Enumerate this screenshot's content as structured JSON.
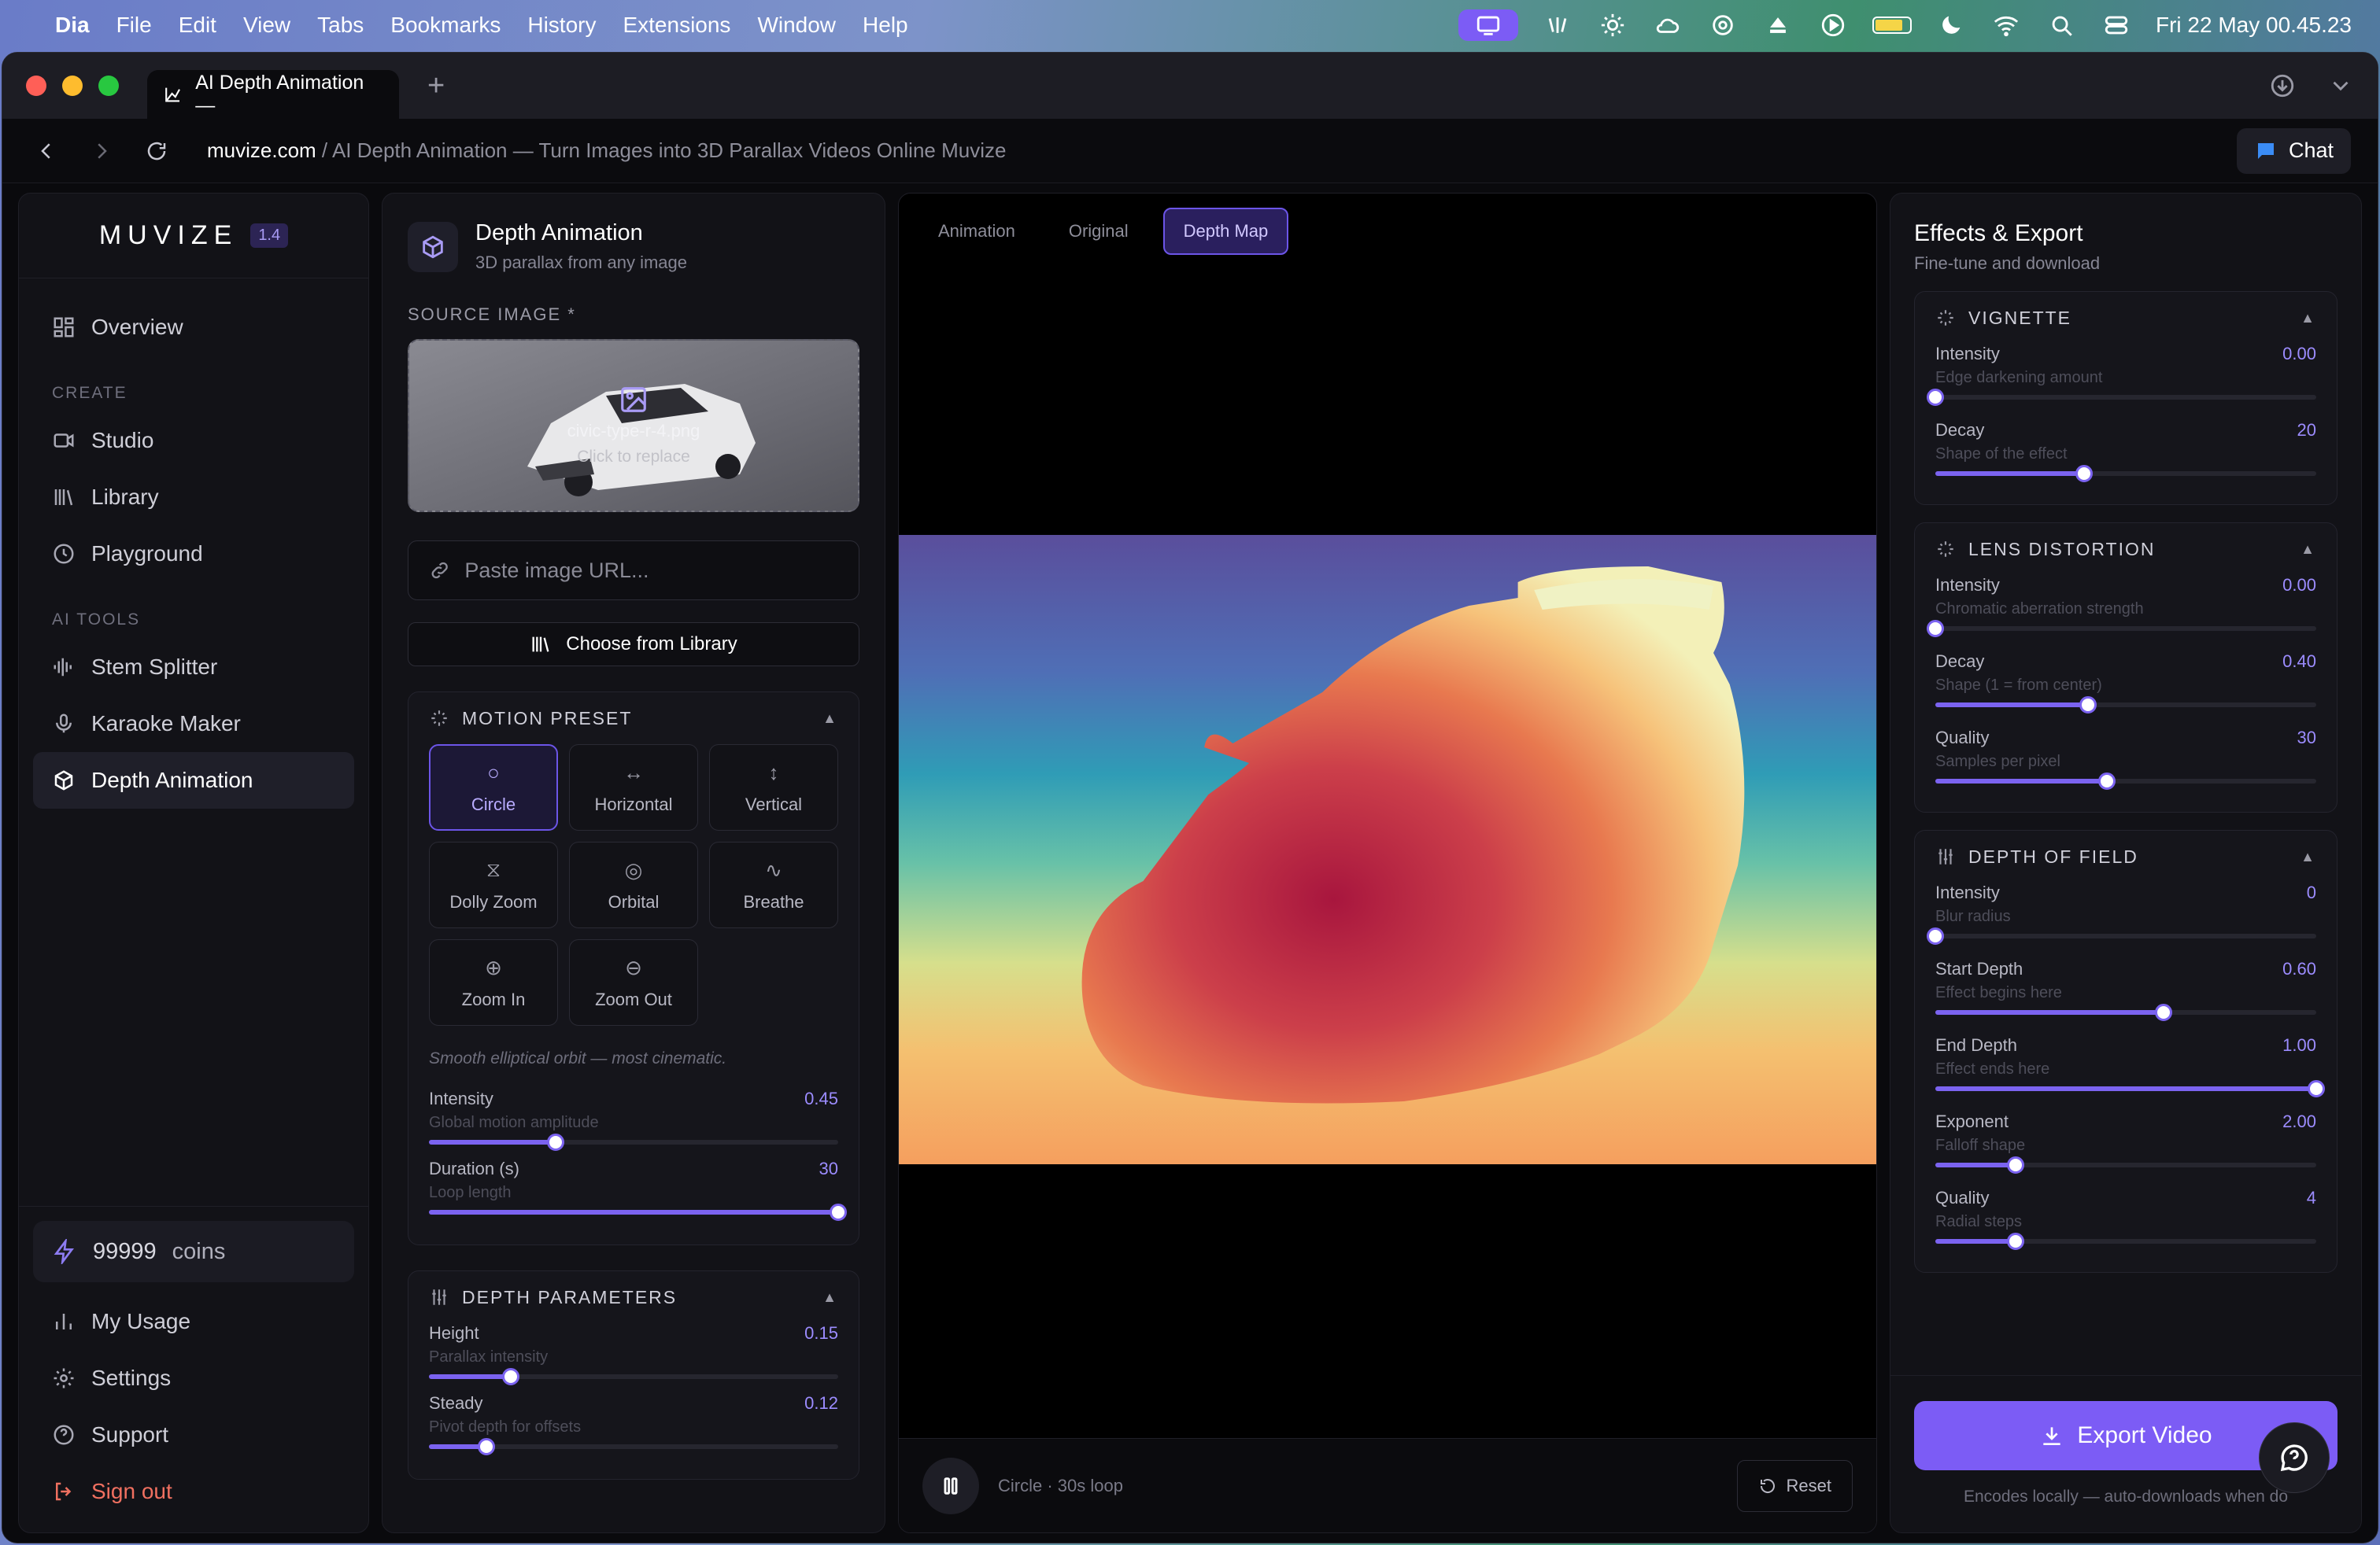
{
  "menubar": {
    "app": "Dia",
    "items": [
      "File",
      "Edit",
      "View",
      "Tabs",
      "Bookmarks",
      "History",
      "Extensions",
      "Window",
      "Help"
    ],
    "clock": "Fri 22 May  00.45.23"
  },
  "browser": {
    "tab_title": "AI Depth Animation —",
    "url_host": "muvize.com",
    "url_path": " / AI Depth Animation — Turn Images into 3D Parallax Videos Online Muvize",
    "chat_label": "Chat"
  },
  "sidebar": {
    "logo": "MUVIZE",
    "version": "1.4",
    "overview": "Overview",
    "create_heading": "CREATE",
    "create_items": [
      "Studio",
      "Library",
      "Playground"
    ],
    "tools_heading": "AI TOOLS",
    "tool_items": [
      "Stem Splitter",
      "Karaoke Maker",
      "Depth Animation"
    ],
    "coins_value": "99999",
    "coins_unit": "coins",
    "bottom_items": [
      "My Usage",
      "Settings",
      "Support"
    ],
    "sign_out": "Sign out"
  },
  "config": {
    "title": "Depth Animation",
    "subtitle": "3D parallax from any image",
    "source_label": "SOURCE IMAGE *",
    "file_name": "civic-type-r-4.png",
    "replace_hint": "Click to replace",
    "url_placeholder": "Paste image URL...",
    "library_button": "Choose from Library",
    "motion_heading": "MOTION PRESET",
    "presets": [
      {
        "label": "Circle",
        "glyph": "○",
        "active": true
      },
      {
        "label": "Horizontal",
        "glyph": "↔",
        "active": false
      },
      {
        "label": "Vertical",
        "glyph": "↕",
        "active": false
      },
      {
        "label": "Dolly Zoom",
        "glyph": "⧖",
        "active": false
      },
      {
        "label": "Orbital",
        "glyph": "◎",
        "active": false
      },
      {
        "label": "Breathe",
        "glyph": "∿",
        "active": false
      },
      {
        "label": "Zoom In",
        "glyph": "⊕",
        "active": false
      },
      {
        "label": "Zoom Out",
        "glyph": "⊖",
        "active": false
      }
    ],
    "preset_description": "Smooth elliptical orbit — most cinematic.",
    "intensity": {
      "label": "Intensity",
      "value": "0.45",
      "sub": "Global motion amplitude",
      "fraction": 0.31
    },
    "duration": {
      "label": "Duration (s)",
      "value": "30",
      "sub": "Loop length",
      "fraction": 1.0
    },
    "depth_heading": "DEPTH PARAMETERS",
    "height": {
      "label": "Height",
      "value": "0.15",
      "sub": "Parallax intensity",
      "fraction": 0.2
    },
    "steady": {
      "label": "Steady",
      "value": "0.12",
      "sub": "Pivot depth for offsets",
      "fraction": 0.14
    }
  },
  "viewer": {
    "tabs": [
      "Animation",
      "Original",
      "Depth Map"
    ],
    "active_tab": "Depth Map",
    "loop_text": "Circle · 30s loop",
    "reset_label": "Reset"
  },
  "effects": {
    "title": "Effects & Export",
    "subtitle": "Fine-tune and download",
    "vignette": {
      "heading": "VIGNETTE",
      "sliders": [
        {
          "label": "Intensity",
          "value": "0.00",
          "sub": "Edge darkening amount",
          "fraction": 0.0
        },
        {
          "label": "Decay",
          "value": "20",
          "sub": "Shape of the effect",
          "fraction": 0.39
        }
      ]
    },
    "lens": {
      "heading": "LENS DISTORTION",
      "sliders": [
        {
          "label": "Intensity",
          "value": "0.00",
          "sub": "Chromatic aberration strength",
          "fraction": 0.0
        },
        {
          "label": "Decay",
          "value": "0.40",
          "sub": "Shape (1 = from center)",
          "fraction": 0.4
        },
        {
          "label": "Quality",
          "value": "30",
          "sub": "Samples per pixel",
          "fraction": 0.45
        }
      ]
    },
    "dof": {
      "heading": "DEPTH OF FIELD",
      "sliders": [
        {
          "label": "Intensity",
          "value": "0",
          "sub": "Blur radius",
          "fraction": 0.0
        },
        {
          "label": "Start Depth",
          "value": "0.60",
          "sub": "Effect begins here",
          "fraction": 0.6
        },
        {
          "label": "End Depth",
          "value": "1.00",
          "sub": "Effect ends here",
          "fraction": 1.0
        },
        {
          "label": "Exponent",
          "value": "2.00",
          "sub": "Falloff shape",
          "fraction": 0.21
        },
        {
          "label": "Quality",
          "value": "4",
          "sub": "Radial steps",
          "fraction": 0.21
        }
      ]
    },
    "export_label": "Export Video",
    "export_note": "Encodes locally — auto-downloads when do"
  },
  "colors": {
    "accent": "#7c5cf5",
    "signout": "#f07060"
  }
}
